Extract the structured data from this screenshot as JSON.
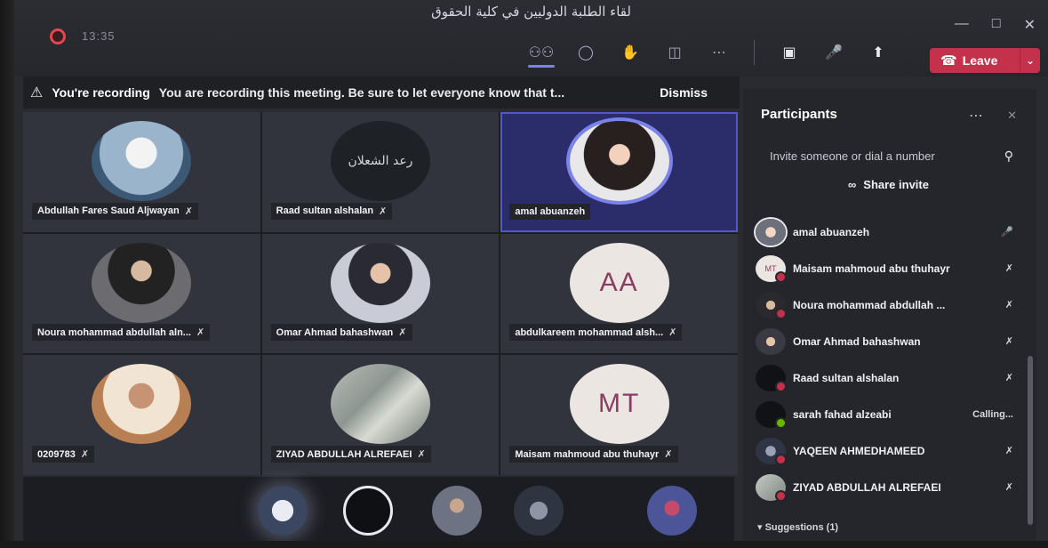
{
  "window": {
    "title": "لقاء الطلبة الدوليين في كلية الحقوق",
    "timer": "13:35"
  },
  "toolbar": {
    "leave_label": "Leave"
  },
  "recording_banner": {
    "title": "You're recording",
    "message": "You are recording this meeting. Be sure to let everyone know that t...",
    "dismiss_label": "Dismiss"
  },
  "tiles": [
    {
      "name": "Abdullah Fares Saud Aljwayan"
    },
    {
      "name": "Raad sultan alshalan",
      "avatar_text": "رعد الشعلان"
    },
    {
      "name": "amal abuanzeh"
    },
    {
      "name": "Noura mohammad abdullah aln..."
    },
    {
      "name": "Omar Ahmad bahashwan"
    },
    {
      "name": "abdulkareem mohammad alsh...",
      "initials": "AA"
    },
    {
      "name": "0209783"
    },
    {
      "name": "ZIYAD ABDULLAH ALREFAEI"
    },
    {
      "name": "Maisam mahmoud abu thuhayr",
      "initials": "MT"
    }
  ],
  "panel": {
    "title": "Participants",
    "invite_placeholder": "Invite someone or dial a number",
    "share_label": "Share invite",
    "participants": [
      {
        "name": "amal abuanzeh",
        "status": ""
      },
      {
        "name": "Maisam mahmoud abu thuhayr",
        "initials": "MT",
        "status": ""
      },
      {
        "name": "Noura mohammad abdullah ...",
        "status": ""
      },
      {
        "name": "Omar Ahmad bahashwan",
        "status": ""
      },
      {
        "name": "Raad sultan alshalan",
        "status": ""
      },
      {
        "name": "sarah fahad alzeabi",
        "status": "Calling..."
      },
      {
        "name": "YAQEEN AHMEDHAMEED",
        "status": ""
      },
      {
        "name": "ZIYAD ABDULLAH ALREFAEI",
        "status": ""
      }
    ],
    "suggestions_label": "Suggestions (1)"
  },
  "colors": {
    "accent": "#7b83eb",
    "leave": "#c4314b",
    "recording": "#e0474f"
  }
}
